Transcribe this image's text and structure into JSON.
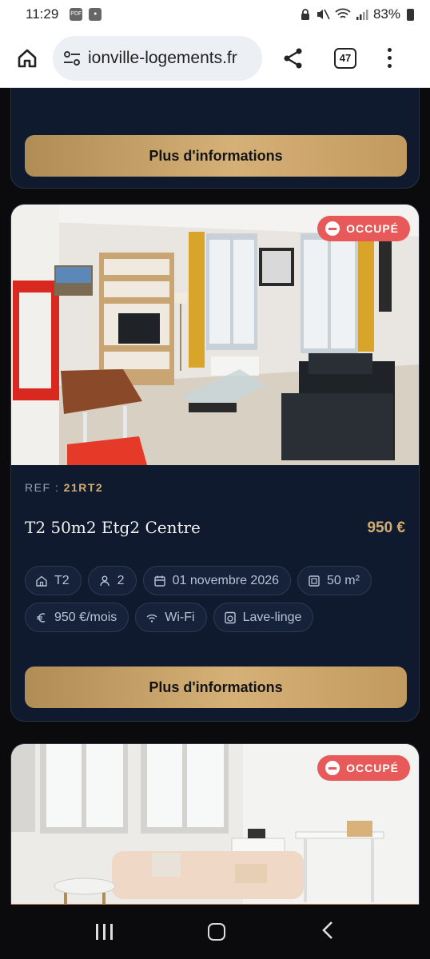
{
  "status_bar": {
    "time": "11:29",
    "battery": "83%"
  },
  "browser": {
    "url": "ionville-logements.fr",
    "tab_count": "47"
  },
  "listings": [
    {
      "button_label": "Plus d'informations"
    },
    {
      "status": "OCCUPÉ",
      "ref_label": "REF :",
      "ref_code": "21RT2",
      "title": "T2 50m2 Etg2 Centre",
      "price": "950 €",
      "features": {
        "type": "T2",
        "persons": "2",
        "date": "01 novembre 2026",
        "area": "50 m²",
        "rent": "950 €/mois",
        "wifi": "Wi-Fi",
        "laundry": "Lave-linge"
      },
      "button_label": "Plus d'informations"
    },
    {
      "status": "OCCUPÉ"
    }
  ]
}
